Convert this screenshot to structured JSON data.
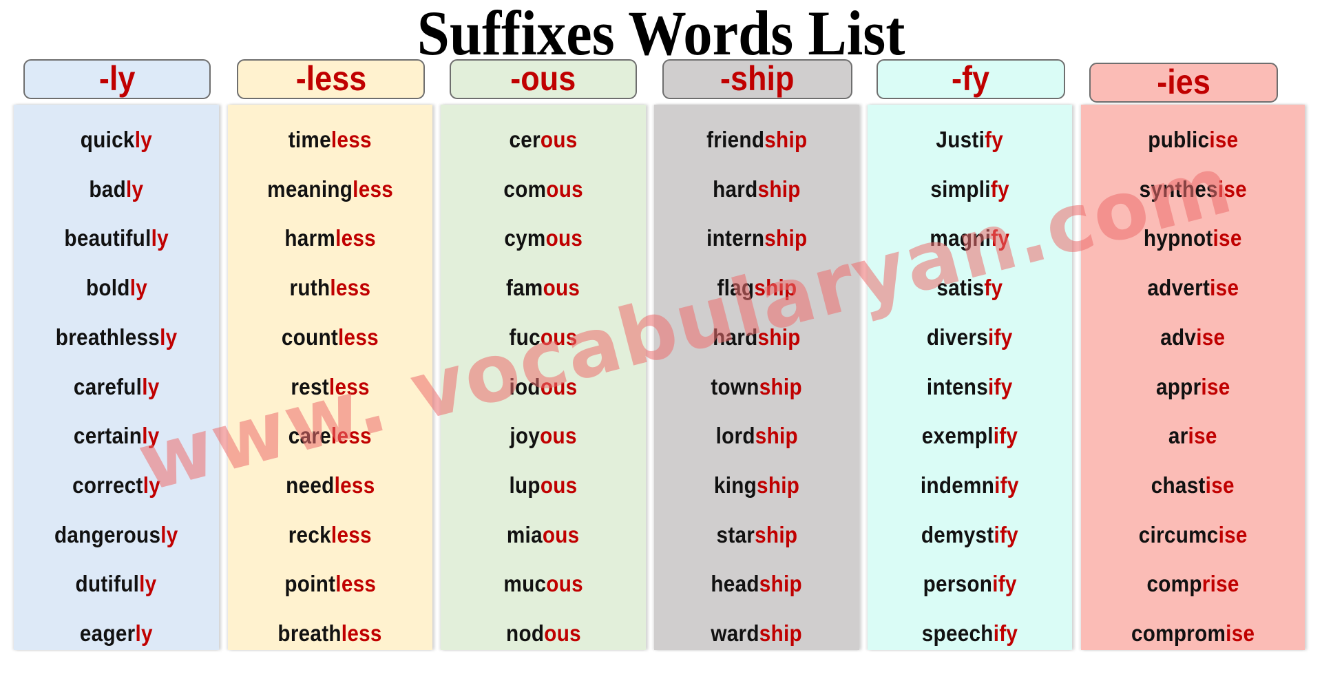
{
  "title": "Suffixes Words List",
  "colors": {
    "suffix_red": "#c00000",
    "text_black": "#111111",
    "header_border": "#6e6e6e"
  },
  "columns": [
    {
      "suffix": "-ly",
      "bg": "#dde9f7",
      "header_bg": "#ddeaf8",
      "words": [
        {
          "stem": "quick",
          "suffix": "ly"
        },
        {
          "stem": "bad",
          "suffix": "ly"
        },
        {
          "stem": "beautiful",
          "suffix": "ly"
        },
        {
          "stem": "bold",
          "suffix": "ly"
        },
        {
          "stem": "breathless",
          "suffix": "ly"
        },
        {
          "stem": "careful",
          "suffix": "ly"
        },
        {
          "stem": "certain",
          "suffix": "ly"
        },
        {
          "stem": "correct",
          "suffix": "ly"
        },
        {
          "stem": "dangerous",
          "suffix": "ly"
        },
        {
          "stem": "dutiful",
          "suffix": "ly"
        },
        {
          "stem": "eager",
          "suffix": "ly"
        }
      ]
    },
    {
      "suffix": "-less",
      "bg": "#fff2cf",
      "header_bg": "#fff2cf",
      "words": [
        {
          "stem": "time",
          "suffix": "less"
        },
        {
          "stem": "meaning",
          "suffix": "less"
        },
        {
          "stem": "harm",
          "suffix": "less"
        },
        {
          "stem": "ruth",
          "suffix": "less"
        },
        {
          "stem": "count",
          "suffix": "less"
        },
        {
          "stem": "rest",
          "suffix": "less"
        },
        {
          "stem": "care",
          "suffix": "less"
        },
        {
          "stem": "need",
          "suffix": "less"
        },
        {
          "stem": "reck",
          "suffix": "less"
        },
        {
          "stem": "point",
          "suffix": "less"
        },
        {
          "stem": "breath",
          "suffix": "less"
        }
      ]
    },
    {
      "suffix": "-ous",
      "bg": "#e2efda",
      "header_bg": "#e2efda",
      "words": [
        {
          "stem": "cer",
          "suffix": "ous"
        },
        {
          "stem": "com",
          "suffix": "ous"
        },
        {
          "stem": "cym",
          "suffix": "ous"
        },
        {
          "stem": "fam",
          "suffix": "ous"
        },
        {
          "stem": "fuc",
          "suffix": "ous"
        },
        {
          "stem": "iod",
          "suffix": "ous"
        },
        {
          "stem": "joy",
          "suffix": "ous"
        },
        {
          "stem": "lup",
          "suffix": "ous"
        },
        {
          "stem": "mia",
          "suffix": "ous"
        },
        {
          "stem": "muc",
          "suffix": "ous"
        },
        {
          "stem": "nod",
          "suffix": "ous"
        }
      ]
    },
    {
      "suffix": "-ship",
      "bg": "#d0cece",
      "header_bg": "#d0cece",
      "words": [
        {
          "stem": "friend",
          "suffix": "ship"
        },
        {
          "stem": "hard",
          "suffix": "ship"
        },
        {
          "stem": "intern",
          "suffix": "ship"
        },
        {
          "stem": "flag",
          "suffix": "ship"
        },
        {
          "stem": "hard",
          "suffix": "ship"
        },
        {
          "stem": "town",
          "suffix": "ship"
        },
        {
          "stem": "lord",
          "suffix": "ship"
        },
        {
          "stem": "king",
          "suffix": "ship"
        },
        {
          "stem": "star",
          "suffix": "ship"
        },
        {
          "stem": "head",
          "suffix": "ship"
        },
        {
          "stem": "ward",
          "suffix": "ship"
        }
      ]
    },
    {
      "suffix": "-fy",
      "bg": "#dafcf6",
      "header_bg": "#dafcf6",
      "words": [
        {
          "stem": "Justi",
          "suffix": "fy"
        },
        {
          "stem": "simpli",
          "suffix": "fy"
        },
        {
          "stem": "magni",
          "suffix": "fy"
        },
        {
          "stem": "satis",
          "suffix": "fy"
        },
        {
          "stem": "divers",
          "suffix": "ify"
        },
        {
          "stem": "intens",
          "suffix": "ify"
        },
        {
          "stem": "exempl",
          "suffix": "ify"
        },
        {
          "stem": "indemn",
          "suffix": "ify"
        },
        {
          "stem": "demyst",
          "suffix": "ify"
        },
        {
          "stem": "person",
          "suffix": "ify"
        },
        {
          "stem": "speech",
          "suffix": "ify"
        }
      ]
    },
    {
      "suffix": "-ies",
      "bg": "#fbbcb6",
      "header_bg": "#fbbcb6",
      "words": [
        {
          "stem": "public",
          "suffix": "ise"
        },
        {
          "stem": "synthes",
          "suffix": "ise"
        },
        {
          "stem": "hypnot",
          "suffix": "ise"
        },
        {
          "stem": "advert",
          "suffix": "ise"
        },
        {
          "stem": "adv",
          "suffix": "ise"
        },
        {
          "stem": "appr",
          "suffix": "ise"
        },
        {
          "stem": "ar",
          "suffix": "ise"
        },
        {
          "stem": "chast",
          "suffix": "ise"
        },
        {
          "stem": "circumc",
          "suffix": "ise"
        },
        {
          "stem": "comp",
          "suffix": "rise"
        },
        {
          "stem": "comprom",
          "suffix": "ise"
        }
      ]
    }
  ],
  "watermark": "www. vocabularyan.com"
}
